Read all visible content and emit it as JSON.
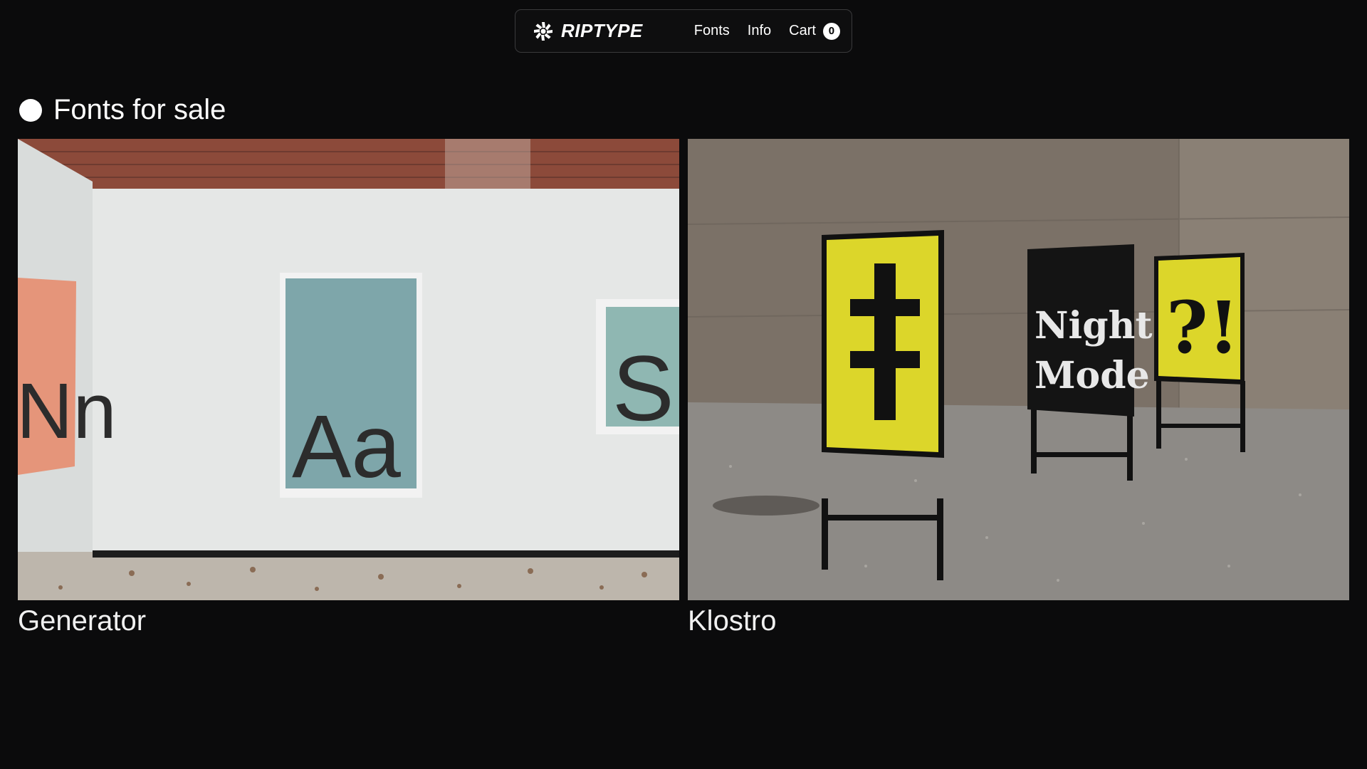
{
  "nav": {
    "brand": "RIPTYPE",
    "brand_icon": "asterisk-burst-icon",
    "links": [
      {
        "label": "Fonts"
      },
      {
        "label": "Info"
      }
    ],
    "cart": {
      "label": "Cart",
      "count": "0"
    }
  },
  "section": {
    "title": "Fonts for sale",
    "bullet_icon": "circle-dot-icon"
  },
  "fonts": [
    {
      "name": "Generator",
      "image": {
        "posters": [
          "Nn",
          "Aa",
          "S"
        ]
      }
    },
    {
      "name": "Klostro",
      "image": {
        "posters": [
          "Night Mode",
          "?!"
        ]
      }
    }
  ],
  "colors": {
    "background": "#0b0b0c",
    "poster_yellow": "#dcd62a",
    "poster_teal": "#7ea6aa",
    "poster_salmon": "#e5957a"
  }
}
